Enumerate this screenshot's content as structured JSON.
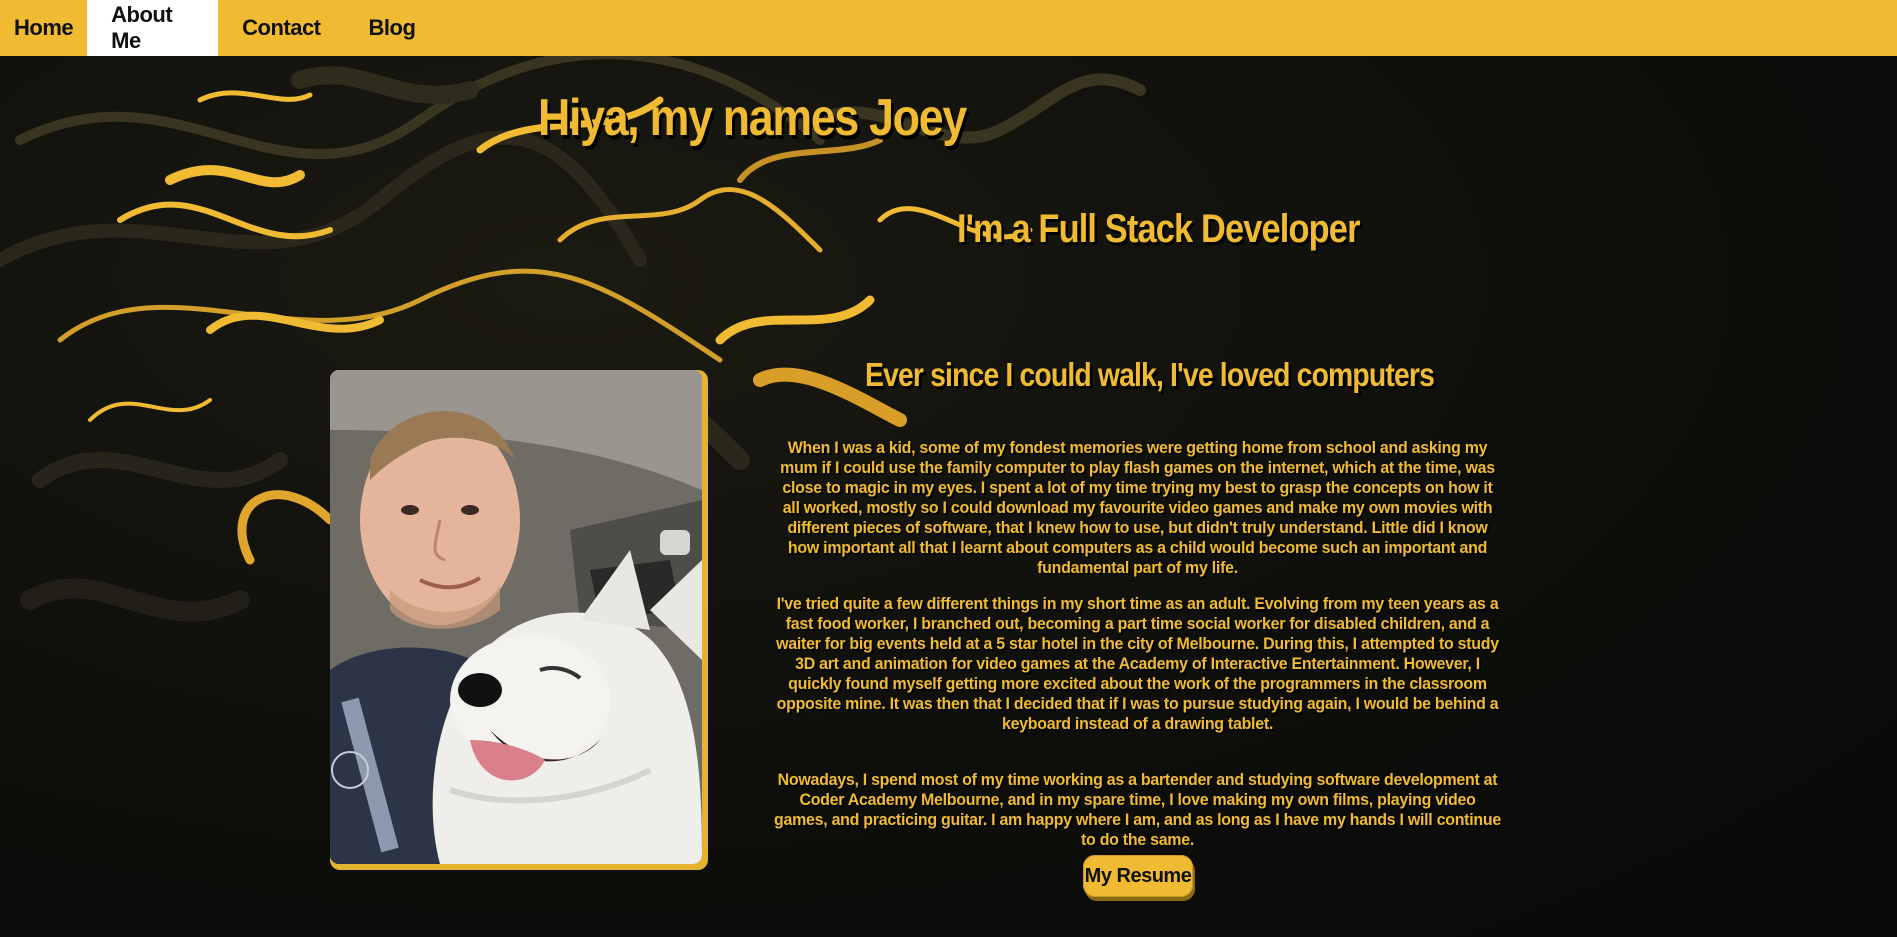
{
  "nav": {
    "items": [
      {
        "label": "Home",
        "active": false
      },
      {
        "label": "About Me",
        "active": true
      },
      {
        "label": "Contact",
        "active": false
      },
      {
        "label": "Blog",
        "active": false
      }
    ]
  },
  "hero": {
    "title": "Hiya, my names Joey",
    "role": "I'm a Full Stack Developer",
    "subtitle": "Ever since I could walk, I've loved computers"
  },
  "bio": {
    "paragraphs": [
      "When I was a kid, some of my fondest memories were getting home from school and asking my mum if I could use the family computer to play flash games on the internet, which at the time, was close to magic in my eyes. I spent a lot of my time trying my best to grasp the concepts on how it all worked, mostly so I could download my favourite video games and make my own movies with different pieces of software, that I knew how to use, but didn't truly understand. Little did I know how important all that I learnt about computers as a child would become such an important and fundamental part of my life.",
      "I've tried quite a few different things in my short time as an adult. Evolving from my teen years as a fast food worker, I branched out, becoming a part time social worker for disabled children, and a waiter for big events held at a 5 star hotel in the city of Melbourne. During this, I attempted to study 3D art and animation for video games at the Academy of Interactive Entertainment. However, I quickly found myself getting more excited about the work of the programmers in the classroom opposite mine. It was then that I decided that if I was to pursue studying again, I would be behind a keyboard instead of a drawing tablet.",
      "Nowadays, I spend most of my time working as a bartender and studying software development at Coder Academy Melbourne, and in my spare time, I love making my own films, playing video games, and practicing guitar. I am happy where I am, and as long as I have my hands I will continue to do the same."
    ]
  },
  "resume_button": {
    "label": "My Resume"
  },
  "colors": {
    "accent": "#f0bb33",
    "background": "#0f0f0c",
    "nav_active": "#ffffff"
  }
}
